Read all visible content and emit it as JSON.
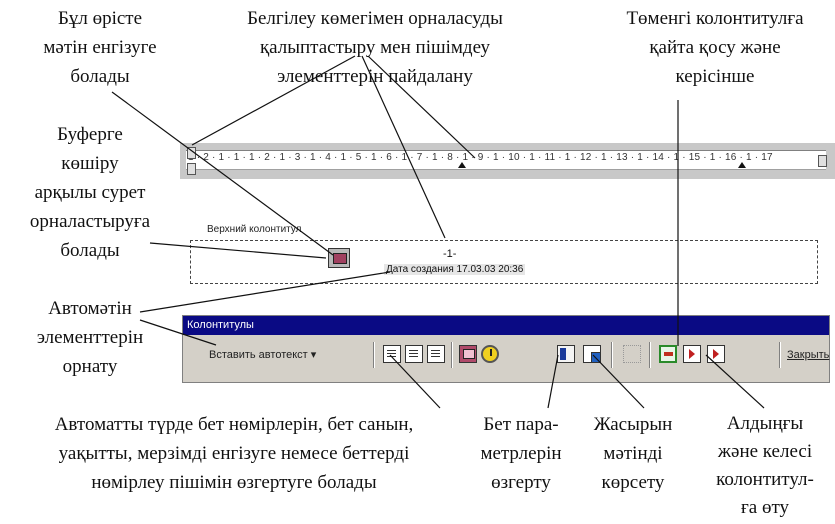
{
  "annotations": {
    "text_in_field": [
      "Бұл өрісте",
      "мәтін енгізуге",
      "болады"
    ],
    "ruler_marks": [
      "Белгілеу көмегімен орналасуды",
      "қалыптастыру мен пішімдеу",
      "элементтерін пайдалану"
    ],
    "switch_footer": [
      "Төменгі колонтитулға",
      "қайта қосу және",
      "керісінше"
    ],
    "clipboard_picture": [
      "Буферге",
      "көшіру",
      "арқылы сурет",
      "орналастыруға",
      "болады"
    ],
    "autotext": [
      "Автомәтін",
      "элементтерін",
      "орнату"
    ],
    "page_numbers": [
      "Автоматты түрде бет нөмірлерін, бет санын,",
      "уақытты, мерзімді енгізуге немесе беттерді",
      "нөмірлеу пішімін өзгертуге болады"
    ],
    "page_params": [
      "Бет пара-",
      "метрлерін",
      "өзгерту"
    ],
    "show_hidden": [
      "Жасырын",
      "мәтінді",
      "көрсету"
    ],
    "prev_next": [
      "Алдыңғы",
      "және келесі",
      "колонтитул-",
      "ға өту"
    ]
  },
  "ruler": {
    "scale": "1 · 2 · 1 · 1 · 1 · 2 · 1 · 3 · 1 · 4 · 1 · 5 · 1 · 6 · 1 · 7 · 1 · 8 · 1 · 9 · 1 · 10 · 1 · 11 · 1 · 12 · 1 · 13 · 1 · 14 · 1 · 15 · 1 · 16 · 1 · 17"
  },
  "document": {
    "header_label": "Верхний колонтитул",
    "page_number": "-1-",
    "date_text": "Дата создания 17.03.03 20:36"
  },
  "toolbar": {
    "title": "Колонтитулы",
    "autotext_label": "Вставить автотекст ▾",
    "close_label": "Закрыть"
  },
  "colors": {
    "title_bar": "#0a0a84",
    "toolbar_bg": "#d4d0c8"
  }
}
